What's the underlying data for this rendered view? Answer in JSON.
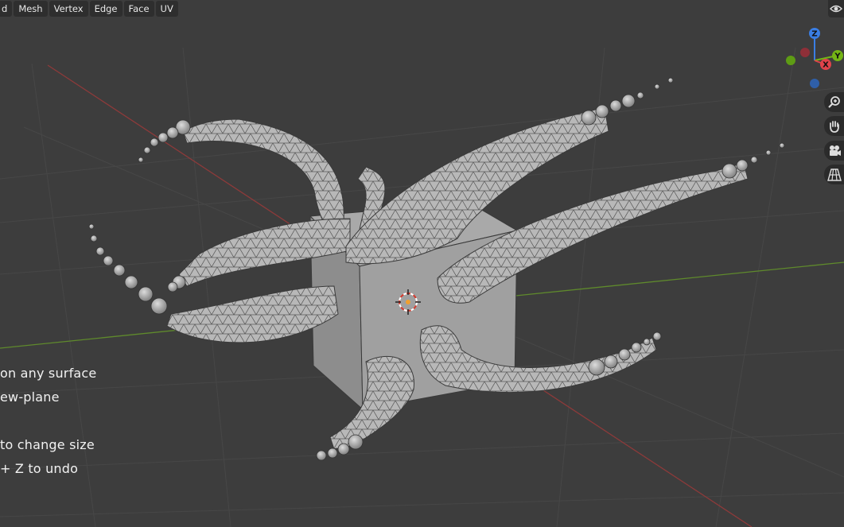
{
  "menu": {
    "items": [
      {
        "label": "d"
      },
      {
        "label": "Mesh"
      },
      {
        "label": "Vertex"
      },
      {
        "label": "Edge"
      },
      {
        "label": "Face"
      },
      {
        "label": "UV"
      }
    ]
  },
  "gizmo": {
    "z_label": "Z",
    "y_label": "Y",
    "x_label": "X",
    "colors": {
      "x": "#e0434b",
      "y": "#74b515",
      "z": "#3a7ee4"
    }
  },
  "nav_tools": [
    {
      "icon": "zoom-icon"
    },
    {
      "icon": "hand-pan-icon"
    },
    {
      "icon": "camera-icon"
    },
    {
      "icon": "grid-perspective-icon"
    }
  ],
  "hints": [
    {
      "text": "on any surface"
    },
    {
      "text": "ew-plane"
    },
    {
      "text": "to change size"
    },
    {
      "text": "+ Z to undo"
    }
  ],
  "colors": {
    "background": "#3d3d3d",
    "grid": "#4a4a4a",
    "x_axis": "#8e3a3a",
    "y_axis": "#5f8a2c",
    "mesh": "#b5b5b5",
    "cube": "#9a9a9a"
  }
}
